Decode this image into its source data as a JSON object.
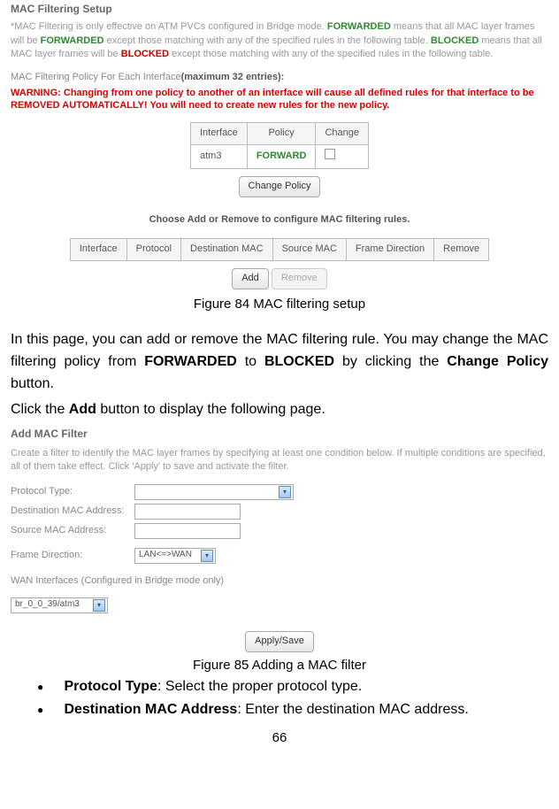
{
  "fig84": {
    "header": "MAC Filtering Setup",
    "desc_parts": {
      "p1a": "*MAC Filtering is only effective on ATM PVCs configured in Bridge mode. ",
      "p1b_forwarded": "FORWARDED",
      "p1c": " means that all MAC layer frames will be ",
      "p1d_forwarded2": "FORWARDED",
      "p1e": " except those matching with any of the specified rules in the following table. ",
      "p1f_blocked": "BLOCKED",
      "p1g": " means that all MAC layer frames will be ",
      "p1h_blocked2": "BLOCKED",
      "p1i": " except those matching with any of the specified rules in the following table."
    },
    "policy_line_a": "MAC Filtering Policy For Each Interface",
    "policy_line_b": "(maximum 32 entries):",
    "warning_a": "WARNING: Changing from one policy to another of an interface will cause all defined rules for that interface to be REMOVED AUTOMATICALLY! You will need to create new rules for the new policy.",
    "table1": {
      "h1": "Interface",
      "h2": "Policy",
      "h3": "Change",
      "r1c1": "atm3",
      "r1c2": "FORWARD"
    },
    "change_policy_btn": "Change Policy",
    "choose_line": "Choose Add or Remove to configure MAC filtering rules.",
    "table2": {
      "h1": "Interface",
      "h2": "Protocol",
      "h3": "Destination MAC",
      "h4": "Source MAC",
      "h5": "Frame Direction",
      "h6": "Remove"
    },
    "add_btn": "Add",
    "remove_btn": "Remove",
    "caption": "Figure 84 MAC filtering setup"
  },
  "body_text": {
    "p1a": "In this page, you can add or remove the MAC filtering rule. You may change the MAC filtering policy from ",
    "p1b": "FORWARDED",
    "p1c": " to ",
    "p1d": "BLOCKED",
    "p1e": " by clicking the ",
    "p1f": "Change Policy",
    "p1g": " button.",
    "p2a": "Click the ",
    "p2b": "Add",
    "p2c": " button to display the following page."
  },
  "fig85": {
    "title": "Add MAC Filter",
    "desc": "Create a filter to identify the MAC layer frames by specifying at least one condition below. If multiple conditions are specified, all of them take effect. Click 'Apply' to save and activate the filter.",
    "protocol_type": "Protocol Type:",
    "dest_mac": "Destination MAC Address:",
    "src_mac": "Source MAC Address:",
    "frame_dir": "Frame Direction:",
    "frame_dir_val": "LAN<=>WAN",
    "wan_if": "WAN Interfaces (Configured in Bridge mode only)",
    "br_val": "br_0_0_39/atm3",
    "apply_btn": "Apply/Save",
    "caption": "Figure 85 Adding a MAC filter"
  },
  "bullets": {
    "b1_label": "Protocol Type",
    "b1_text": ": Select the proper protocol type.",
    "b2_label": "Destination MAC Address",
    "b2_text": ": Enter the destination MAC address."
  },
  "page_number": "66"
}
